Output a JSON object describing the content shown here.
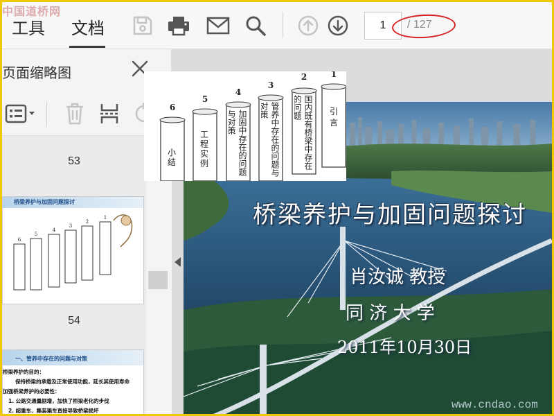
{
  "toolbar": {
    "watermark": "中国道桥网",
    "tabs": [
      "工具",
      "文档"
    ],
    "current_page": "1",
    "total_pages": "/ 127",
    "icons": [
      "save-icon",
      "print-icon",
      "mail-icon",
      "search-icon",
      "page-up-icon",
      "page-down-icon"
    ]
  },
  "panel": {
    "title": "页面缩略图",
    "thumbnails": [
      {
        "page": "53"
      },
      {
        "page": "54",
        "header": "桥梁养护与加固问题探讨"
      },
      {
        "header": "一、管养中存在的问题与对策",
        "lines": [
          "桥梁养护的目的：",
          "保持桥梁的承载及正常使用功能，延长其使用寿命",
          "加强桥梁养护的必要性：",
          "1. 公路交通量剧增，加快了桥梁老化的步伐",
          "2. 超重车、集装箱车直接导致桥梁损坏"
        ]
      }
    ]
  },
  "outline": {
    "items": [
      {
        "num": "6",
        "text": "小结"
      },
      {
        "num": "5",
        "text": "工程实例"
      },
      {
        "num": "4",
        "text": "加固中存在的问题与对策"
      },
      {
        "num": "3",
        "text": "管养中存在的问题与对策"
      },
      {
        "num": "2",
        "text": "国内既有桥梁中存在的问题"
      },
      {
        "num": "1",
        "text": "引言"
      }
    ]
  },
  "slide": {
    "title": "桥梁养护与加固问题探讨",
    "author": "肖汝诚   教授",
    "school": "同  济  大  学",
    "date": "2011年10月30日",
    "watermark": "www.cndao.com"
  }
}
